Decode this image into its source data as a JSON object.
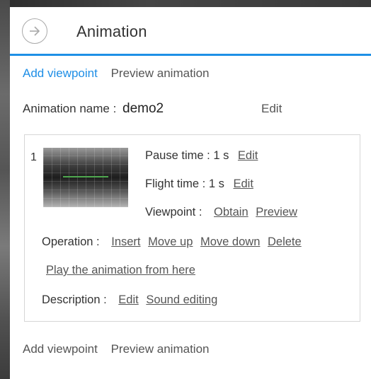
{
  "panel": {
    "title": "Animation"
  },
  "tabs": {
    "add_viewpoint": "Add viewpoint",
    "preview_animation": "Preview animation"
  },
  "animation": {
    "name_label": "Animation name :",
    "name_value": "demo2",
    "edit_label": "Edit"
  },
  "viewpoint_item": {
    "index": "1",
    "pause_time_label": "Pause time :",
    "pause_time_value": "1 s",
    "flight_time_label": "Flight time :",
    "flight_time_value": "1 s",
    "edit_label": "Edit",
    "viewpoint_label": "Viewpoint :",
    "obtain_label": "Obtain",
    "preview_label": "Preview",
    "operation_label": "Operation :",
    "insert_label": "Insert",
    "move_up_label": "Move up",
    "move_down_label": "Move down",
    "delete_label": "Delete",
    "play_from_here_label": "Play the animation from here",
    "description_label": "Description :",
    "sound_editing_label": "Sound editing"
  },
  "footer": {
    "add_viewpoint": "Add viewpoint",
    "preview_animation": "Preview animation"
  },
  "colors": {
    "accent": "#1e8ee6",
    "header_border": "#1e90e6"
  },
  "icons": {
    "back": "arrow-right-circle-icon"
  }
}
